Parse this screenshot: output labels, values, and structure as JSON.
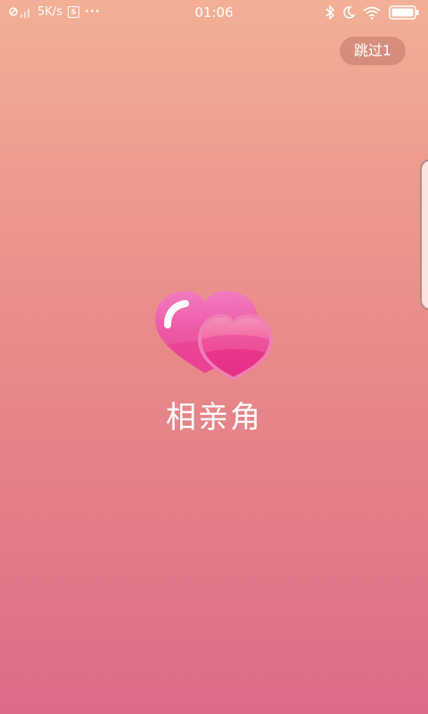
{
  "status_bar": {
    "speed": "5K/s",
    "s_badge": "S",
    "more": "···",
    "time": "01:06",
    "icons": [
      "signal-icon",
      "bluetooth-icon",
      "moon-icon",
      "wifi-icon",
      "battery-icon"
    ]
  },
  "splash": {
    "skip_label": "跳过1",
    "app_name": "相亲角"
  },
  "colors": {
    "gradient_top": "#f3b096",
    "gradient_bottom": "#de6a88",
    "logo_pink_light": "#f26bb5",
    "logo_pink_dark": "#e8338a"
  }
}
